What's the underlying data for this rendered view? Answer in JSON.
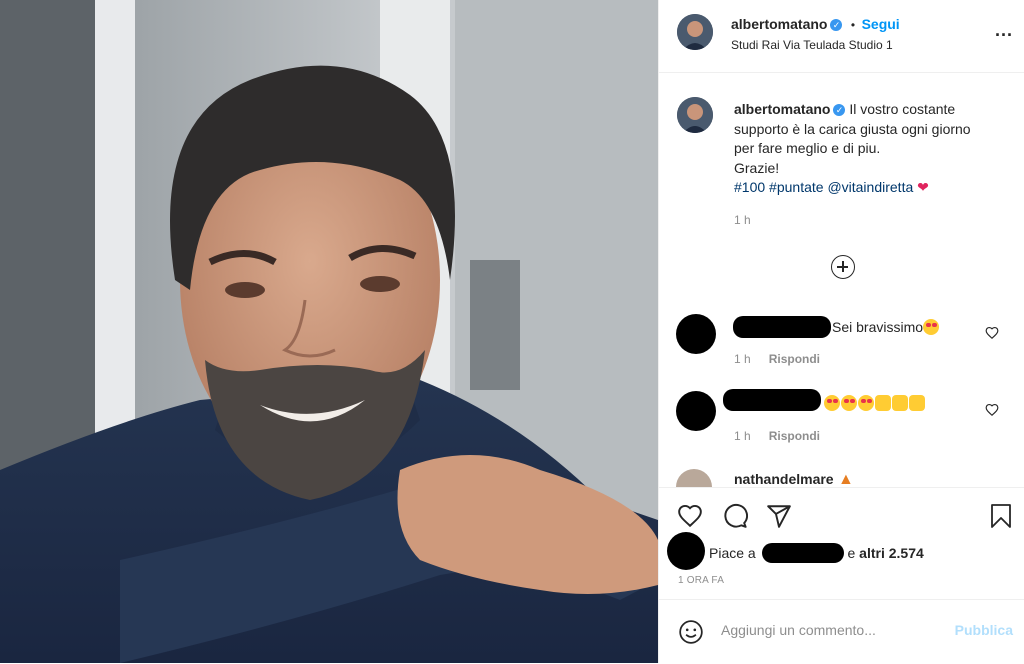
{
  "header": {
    "username": "albertomatano",
    "follow_label": "Segui",
    "separator": "•",
    "location": "Studi Rai Via Teulada Studio 1",
    "more_label": "..."
  },
  "caption": {
    "username": "albertomatano",
    "line1": "Il vostro costante",
    "line2": "supporto è la carica giusta ogni giorno",
    "line3": "per fare meglio e di piu.",
    "line4": "Grazie!",
    "tag1": "#100",
    "tag2": "#puntate",
    "tag3": "@vitaindiretta",
    "time": "1 h"
  },
  "comments": [
    {
      "text": "Sei bravissimo",
      "time": "1 h",
      "reply": "Rispondi"
    },
    {
      "text": "",
      "time": "1 h",
      "reply": "Rispondi"
    },
    {
      "username": "nathandelmare"
    }
  ],
  "likes": {
    "prefix": "Piace a",
    "suffix_conj": "e",
    "others": "altri 2.574"
  },
  "timestamp": "1 ORA FA",
  "add_comment": {
    "placeholder": "Aggiungi un commento...",
    "publish": "Pubblica"
  },
  "colors": {
    "accent": "#0095f6",
    "verified": "#3897f0",
    "publish_disabled": "#b2dffc",
    "muted": "#8e8e8e"
  }
}
